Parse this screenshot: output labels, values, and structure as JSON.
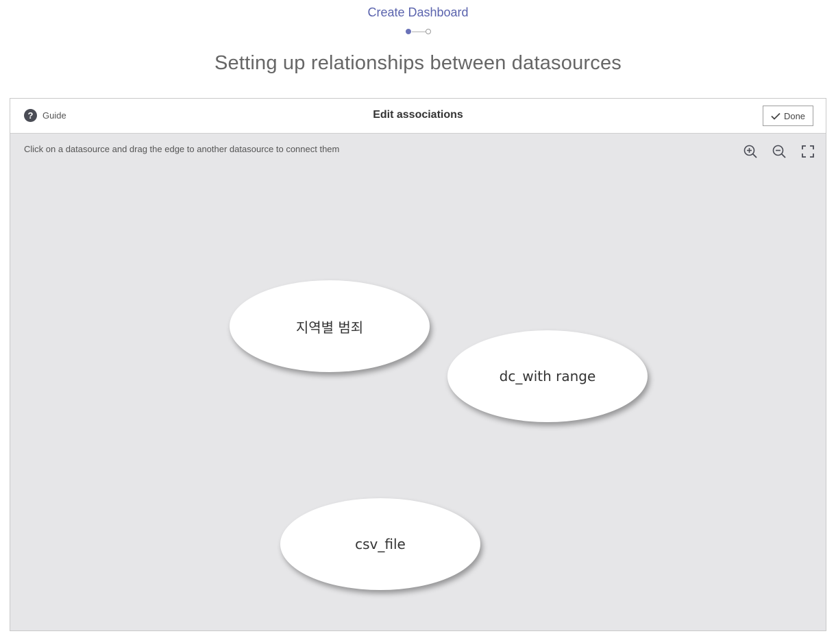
{
  "wizard": {
    "title": "Create Dashboard",
    "steps": {
      "current": 1,
      "total": 2
    }
  },
  "page_heading": "Setting up relationships between datasources",
  "panel": {
    "guide_label": "Guide",
    "title": "Edit associations",
    "done_label": "Done",
    "instruction": "Click on a datasource and drag the edge to another datasource to connect them",
    "controls": [
      "zoom-in-icon",
      "zoom-out-icon",
      "fit-screen-icon"
    ]
  },
  "datasources": [
    {
      "name": "지역별 범죄"
    },
    {
      "name": "dc_with range"
    },
    {
      "name": "csv_file"
    }
  ],
  "colors": {
    "accent": "#5a63ad",
    "canvas_bg": "#e6e6e8",
    "node_bg": "#ffffff"
  }
}
